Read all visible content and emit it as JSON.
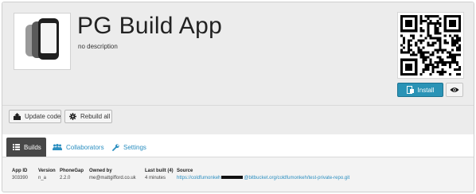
{
  "app": {
    "title": "PG Build App",
    "description": "no description"
  },
  "header_actions": {
    "install_label": "Install",
    "install_icon": "install-icon",
    "preview_icon": "eye-icon",
    "accent_color": "#2a93b6"
  },
  "actions": {
    "update_code_label": "Update code",
    "update_code_icon": "upload-icon",
    "rebuild_all_label": "Rebuild all",
    "rebuild_all_icon": "gear-icon"
  },
  "tabs": [
    {
      "label": "Builds",
      "icon": "list-icon",
      "active": true
    },
    {
      "label": "Collaborators",
      "icon": "users-icon",
      "active": false
    },
    {
      "label": "Settings",
      "icon": "wrench-icon",
      "active": false
    }
  ],
  "details": {
    "app_id_label": "App ID",
    "app_id": "303390",
    "version_label": "Version",
    "version": "n_a",
    "phonegap_label": "PhoneGap",
    "phonegap": "2.2.0",
    "owned_by_label": "Owned by",
    "owned_by": "me@mattgifford.co.uk",
    "last_built_label": "Last built (4)",
    "last_built": "4 minutes",
    "source_label": "Source",
    "source_prefix": "https://coldfumonkeh",
    "source_suffix": "@bitbucket.org/coldfumonkeh/test-private-repo.git"
  }
}
